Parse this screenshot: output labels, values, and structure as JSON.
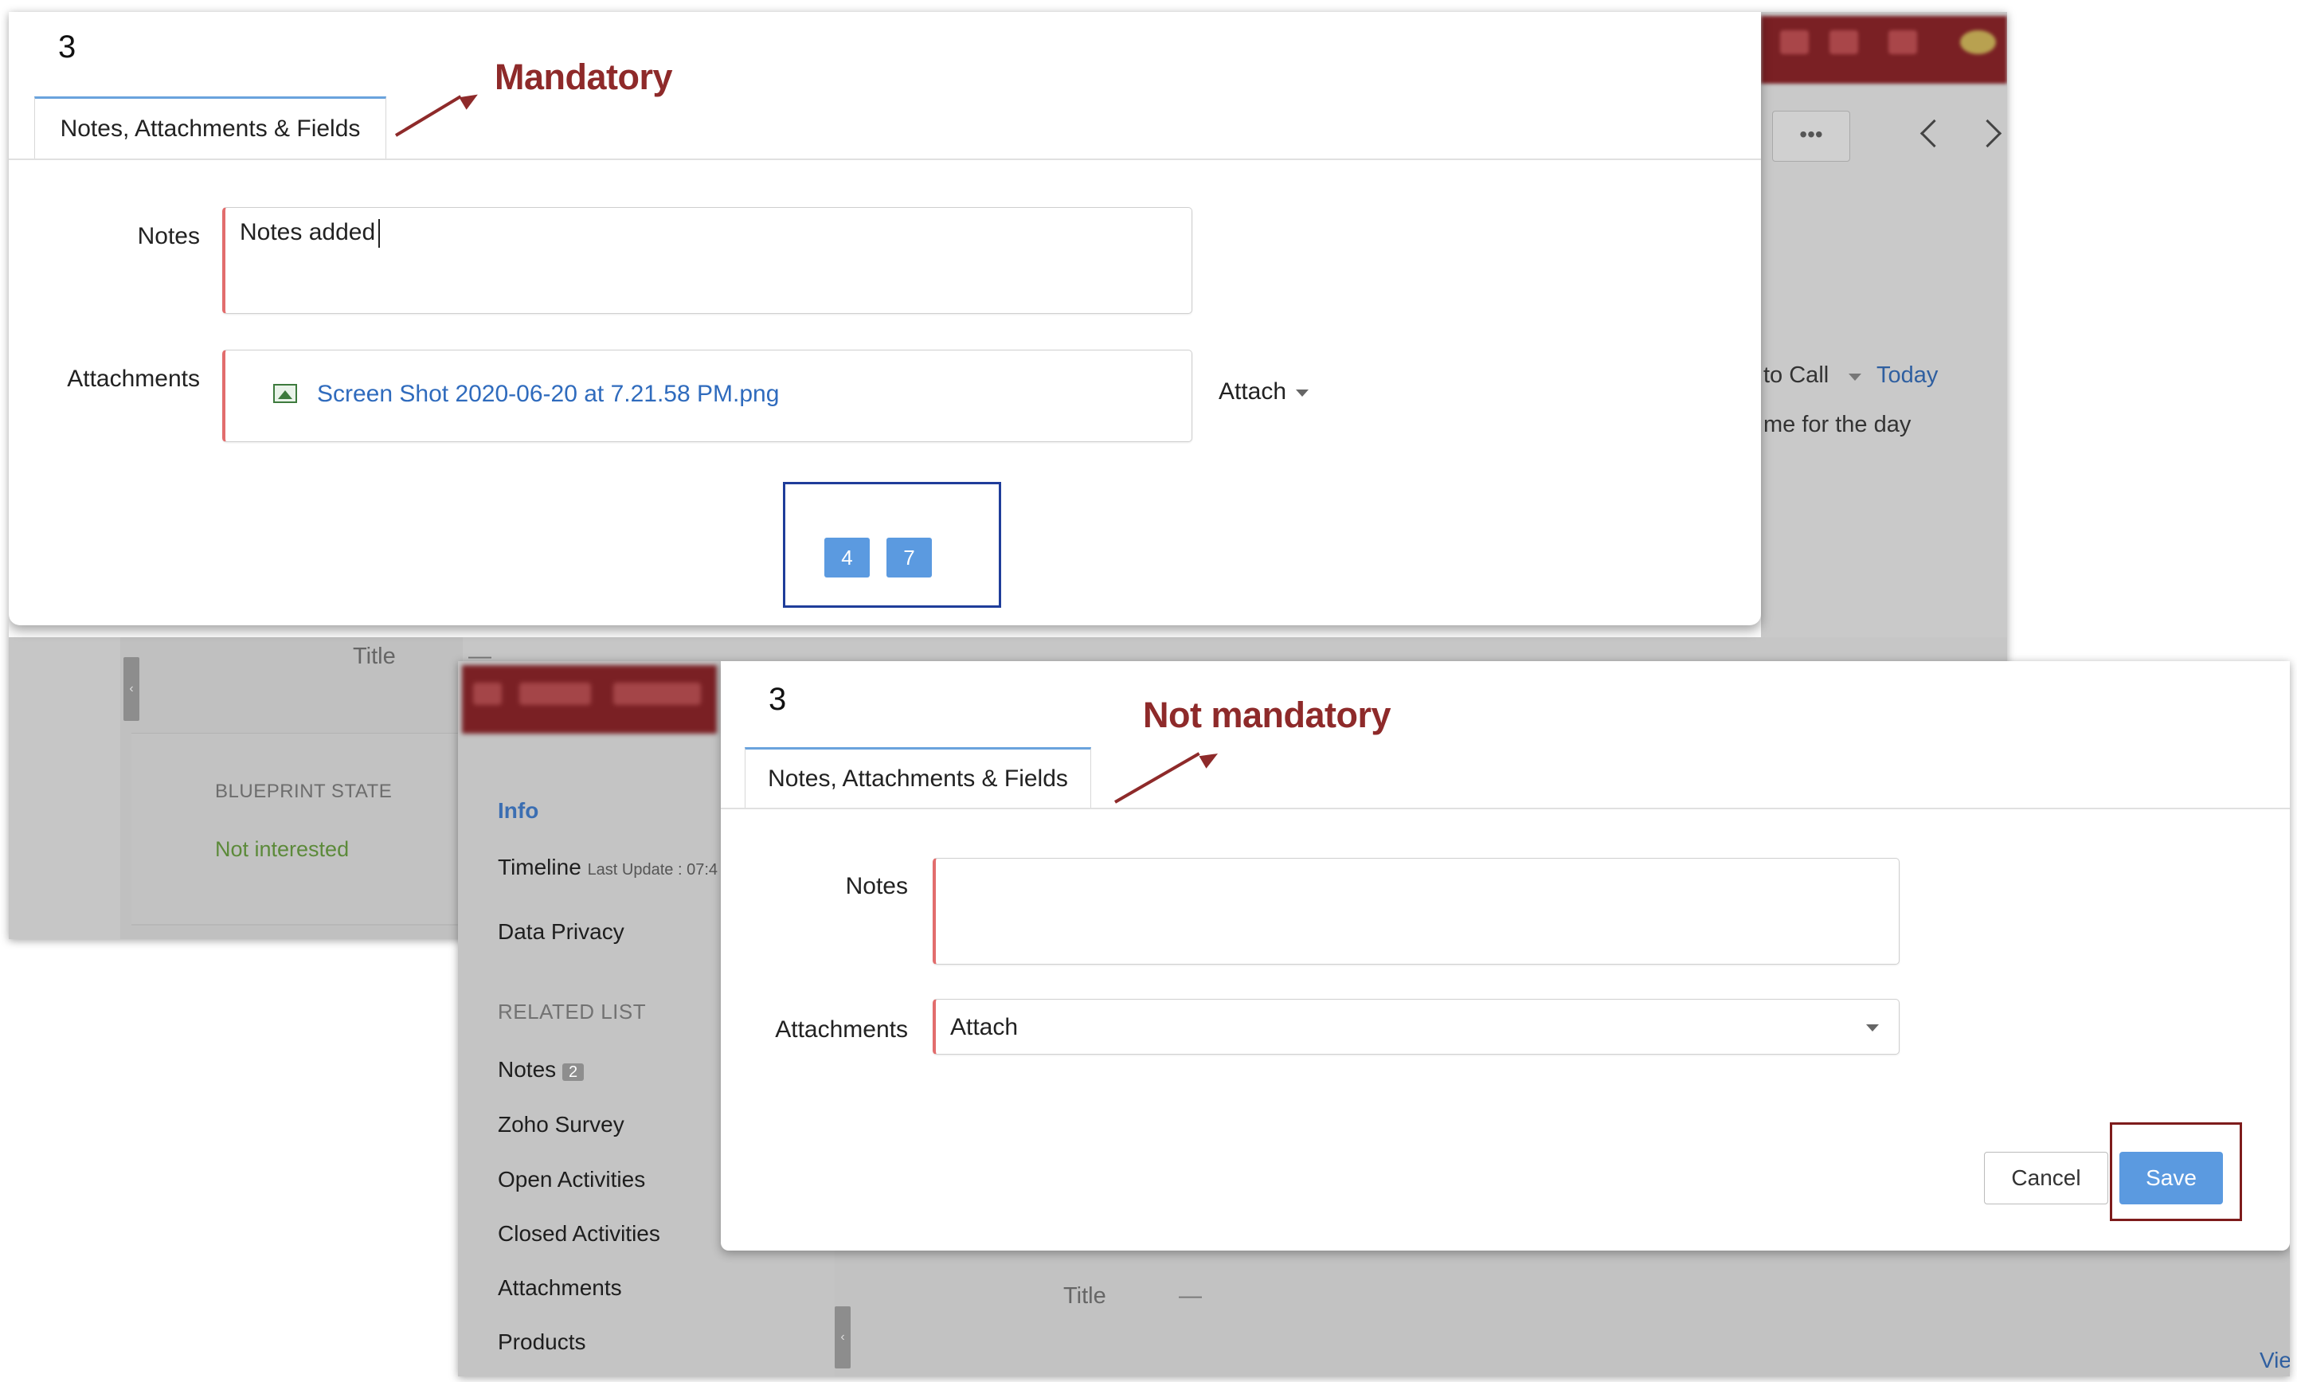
{
  "mandatory_dialog": {
    "step": "3",
    "tab_label": "Notes, Attachments & Fields",
    "annotation": "Mandatory",
    "notes_label": "Notes",
    "notes_value": "Notes added",
    "attachments_label": "Attachments",
    "attachment_file": "Screen Shot 2020-06-20 at 7.21.58 PM.png",
    "attach_button": "Attach",
    "page_badges": [
      "4",
      "7"
    ]
  },
  "background_top": {
    "more_label": "•••",
    "call_label": "to Call",
    "today_label": "Today",
    "day_label": "me for the day",
    "title_label": "Title",
    "title_value": "—",
    "blueprint_state_label": "BLUEPRINT STATE",
    "blueprint_state_value": "Not interested"
  },
  "sidebar": {
    "info": "Info",
    "timeline": "Timeline",
    "timeline_sub": "Last Update : 07:4",
    "data_privacy": "Data Privacy",
    "related_list": "RELATED LIST",
    "items": [
      {
        "label": "Notes",
        "count": "2"
      },
      {
        "label": "Zoho Survey"
      },
      {
        "label": "Open Activities"
      },
      {
        "label": "Closed Activities"
      },
      {
        "label": "Attachments"
      },
      {
        "label": "Products"
      }
    ]
  },
  "optional_dialog": {
    "step": "3",
    "tab_label": "Notes, Attachments & Fields",
    "annotation": "Not mandatory",
    "notes_label": "Notes",
    "notes_value": "",
    "attachments_label": "Attachments",
    "attach_select": "Attach",
    "cancel_label": "Cancel",
    "save_label": "Save"
  },
  "background_bottom": {
    "title_label": "Title",
    "title_value": "—",
    "view_link": "Vie"
  },
  "colors": {
    "accent_blue": "#5b9ae0",
    "annotation_red": "#8e2a2a",
    "required_border": "#e26d6d",
    "link_blue": "#2f6bbd",
    "state_green": "#5c8a3a"
  }
}
